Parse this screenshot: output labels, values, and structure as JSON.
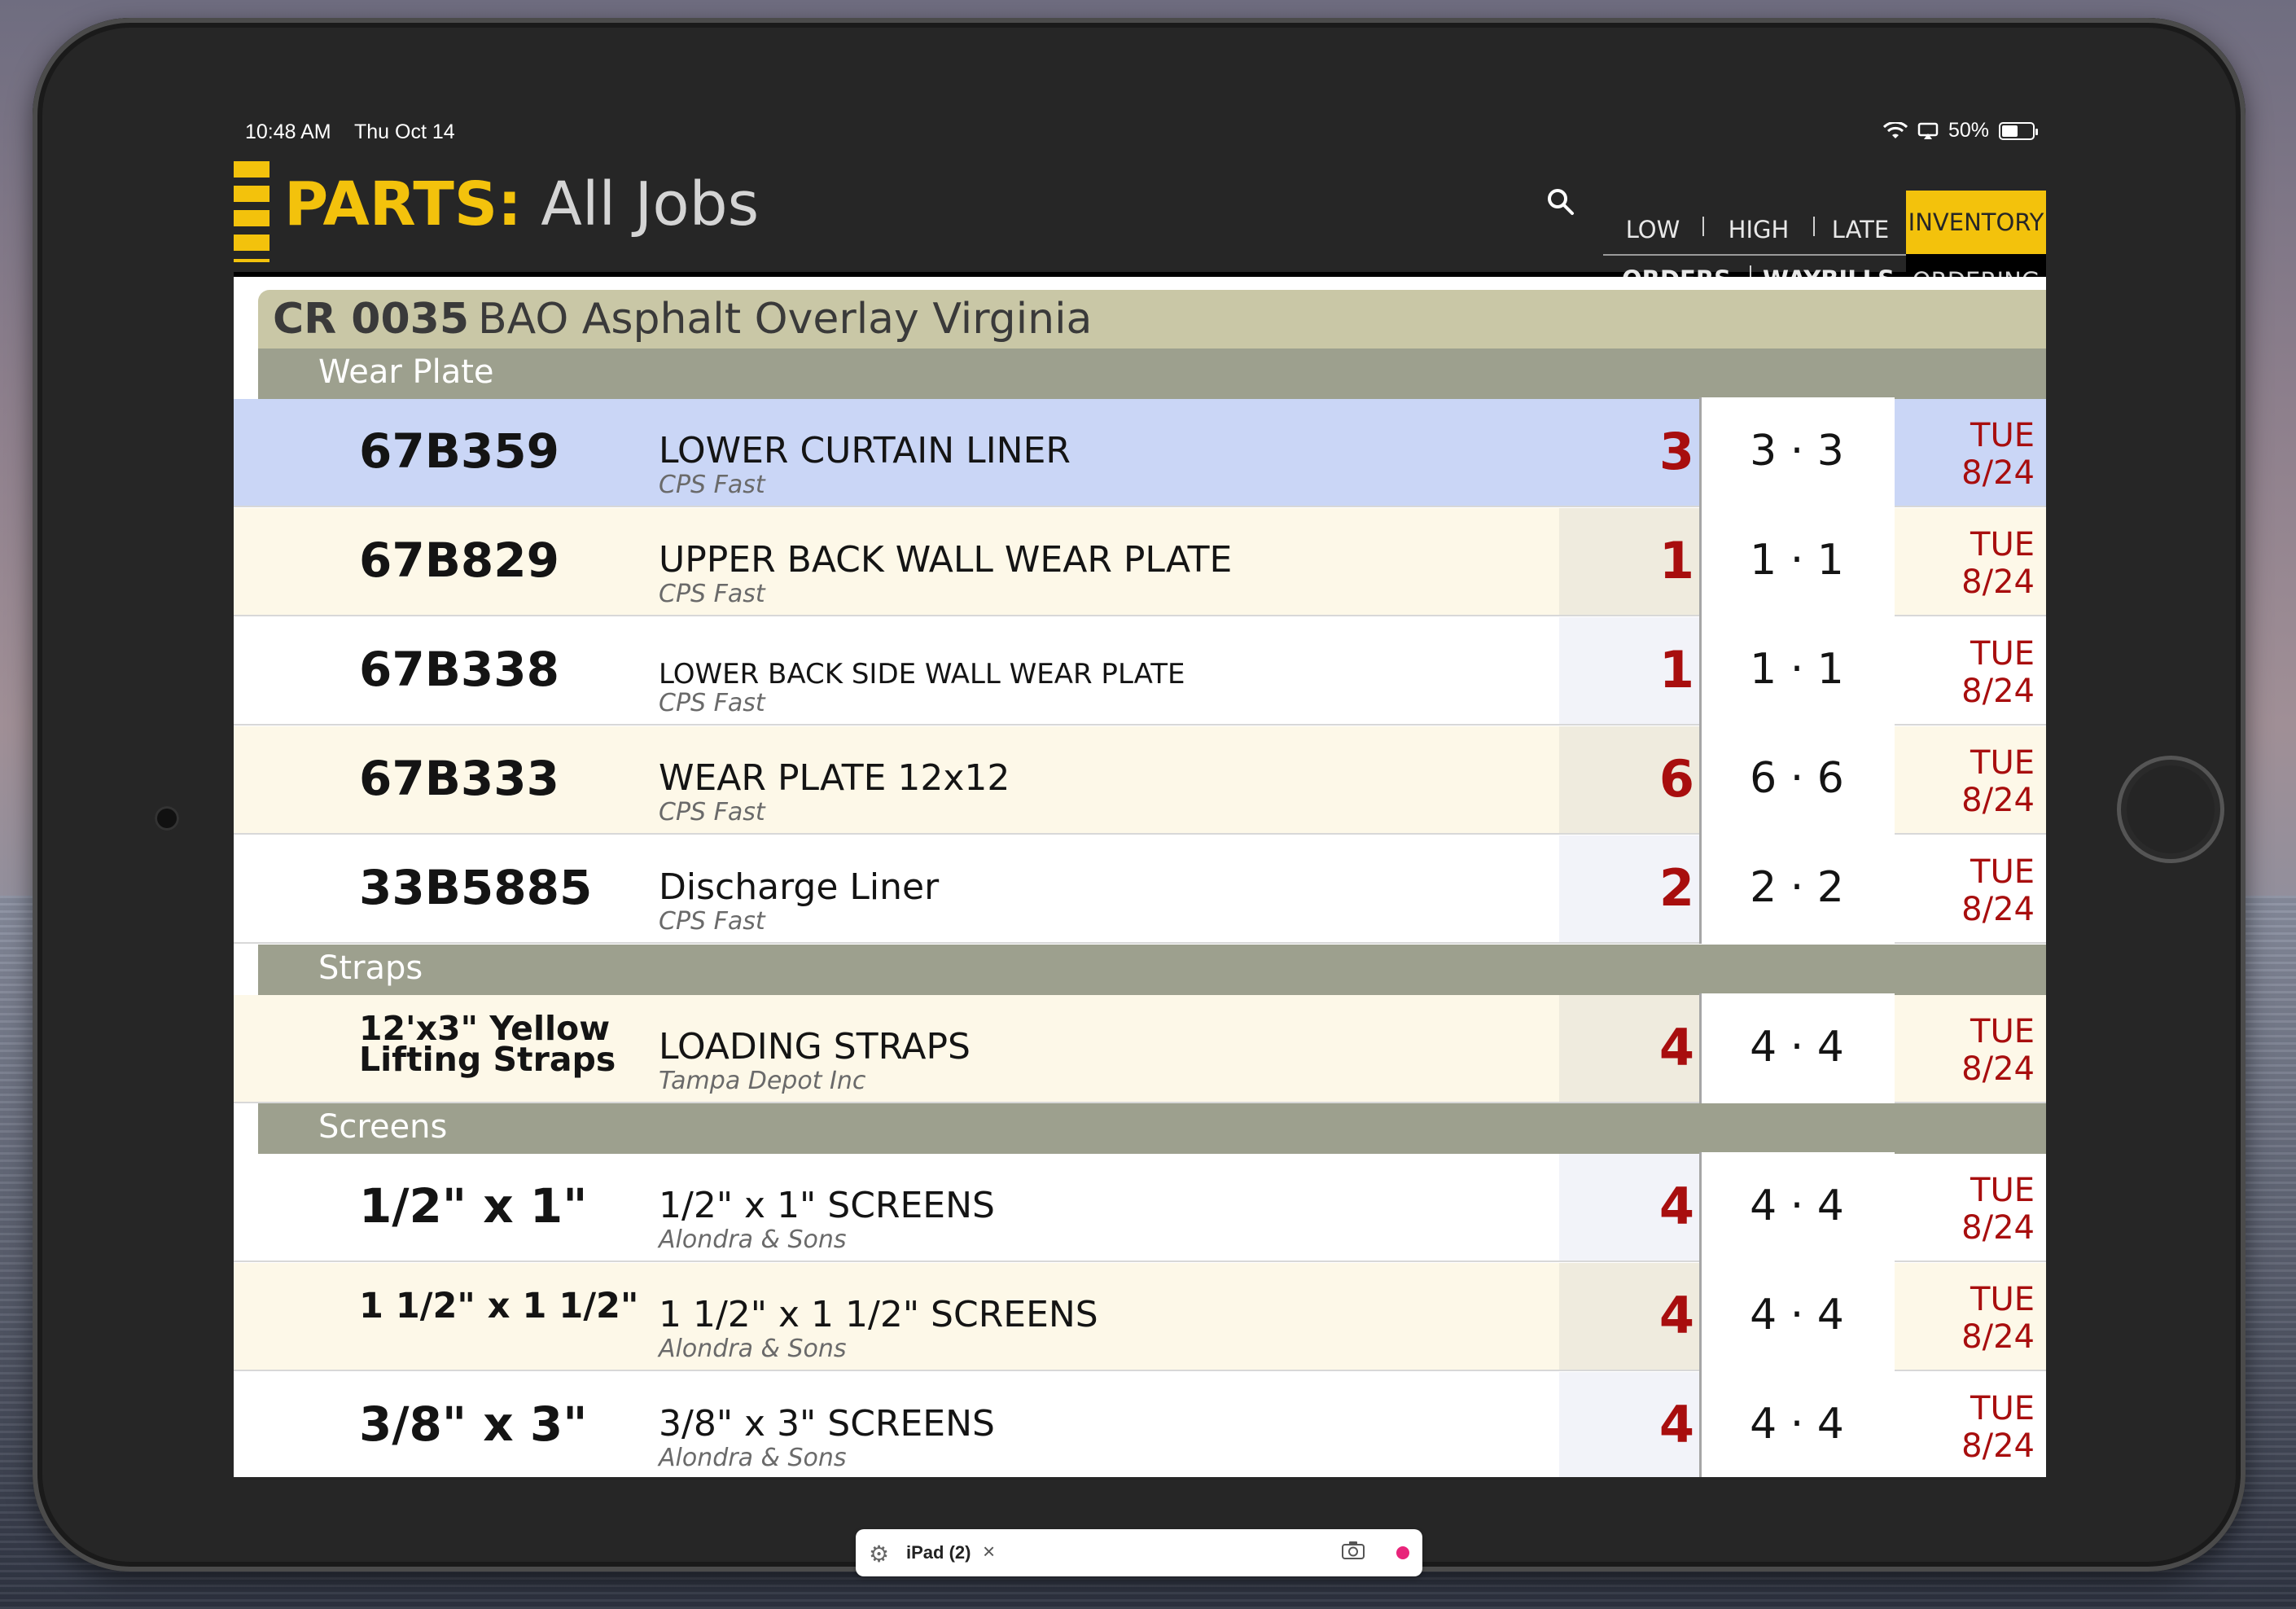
{
  "status": {
    "time": "10:48 AM",
    "date": "Thu Oct 14",
    "battery": "50%"
  },
  "header": {
    "title_prefix": "PARTS:",
    "title_suffix": "All Jobs"
  },
  "tabs": {
    "low": "LOW",
    "high": "HIGH",
    "late": "LATE",
    "inventory": "INVENTORY",
    "orders": "ORDERS",
    "waybills": "WAYBILLS",
    "ordering": "ORDERING"
  },
  "job": {
    "id": "CR 0035",
    "name": "BAO Asphalt Overlay Virginia"
  },
  "categories": [
    {
      "name": "Wear Plate",
      "items": [
        {
          "part": "67B359",
          "desc": "LOWER CURTAIN LINER",
          "vendor": "CPS Fast",
          "qty": "3",
          "ratio": "3 · 3",
          "day": "TUE",
          "date": "8/24"
        },
        {
          "part": "67B829",
          "desc": "UPPER BACK WALL WEAR PLATE",
          "vendor": "CPS Fast",
          "qty": "1",
          "ratio": "1 · 1",
          "day": "TUE",
          "date": "8/24"
        },
        {
          "part": "67B338",
          "desc": "LOWER BACK SIDE WALL WEAR PLATE",
          "vendor": "CPS Fast",
          "qty": "1",
          "ratio": "1 · 1",
          "day": "TUE",
          "date": "8/24"
        },
        {
          "part": "67B333",
          "desc": "WEAR PLATE 12x12",
          "vendor": "CPS Fast",
          "qty": "6",
          "ratio": "6 · 6",
          "day": "TUE",
          "date": "8/24"
        },
        {
          "part": "33B5885",
          "desc": "Discharge Liner",
          "vendor": "CPS Fast",
          "qty": "2",
          "ratio": "2 · 2",
          "day": "TUE",
          "date": "8/24"
        }
      ]
    },
    {
      "name": "Straps",
      "items": [
        {
          "part": "12'x3\" Yellow Lifting Straps",
          "desc": "LOADING STRAPS",
          "vendor": "Tampa Depot Inc",
          "qty": "4",
          "ratio": "4 · 4",
          "day": "TUE",
          "date": "8/24"
        }
      ]
    },
    {
      "name": "Screens",
      "items": [
        {
          "part": "1/2\" x 1\"",
          "desc": "1/2\" x 1\" SCREENS",
          "vendor": "Alondra & Sons",
          "qty": "4",
          "ratio": "4 · 4",
          "day": "TUE",
          "date": "8/24"
        },
        {
          "part": "1 1/2\" x 1 1/2\"",
          "desc": "1 1/2\" x 1 1/2\" SCREENS",
          "vendor": "Alondra & Sons",
          "qty": "4",
          "ratio": "4 · 4",
          "day": "TUE",
          "date": "8/24"
        },
        {
          "part": "3/8\" x 3\"",
          "desc": "3/8\" x 3\" SCREENS",
          "vendor": "Alondra & Sons",
          "qty": "4",
          "ratio": "4 · 4",
          "day": "TUE",
          "date": "8/24"
        }
      ]
    }
  ],
  "toolbar": {
    "device": "iPad (2)",
    "close": "×"
  },
  "colors": {
    "accent": "#f3c20c",
    "quantity": "#a80e0e",
    "selected_row": "#cad6f6",
    "category_bar": "#9da08e",
    "job_bar": "#c9c7a6"
  }
}
